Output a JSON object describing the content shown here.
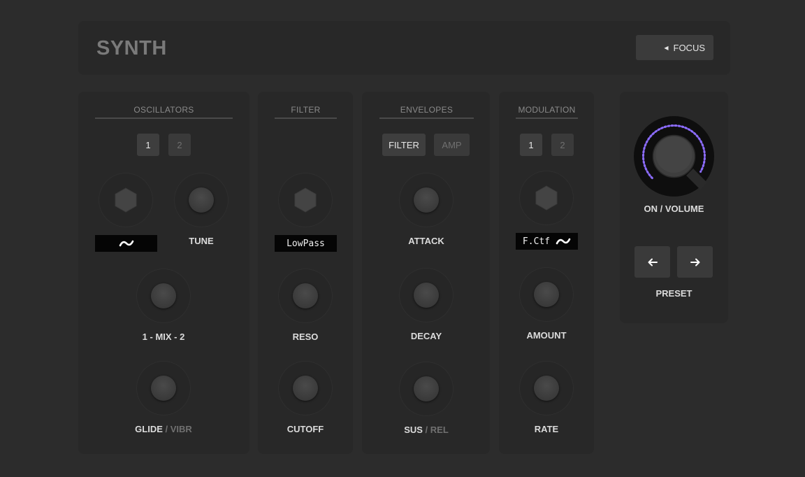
{
  "header": {
    "title": "SYNTH",
    "focus_label": "FOCUS",
    "focus_icon": "triangle-left-icon"
  },
  "oscillators": {
    "title": "OSCILLATORS",
    "toggles": [
      "1",
      "2"
    ],
    "waveform_icon": "sine-wave-icon",
    "tune_label": "TUNE",
    "mix_label": "1 - MIX - 2",
    "glide_label": "GLIDE",
    "vibr_label": "VIBR",
    "slash": "/"
  },
  "filter": {
    "title": "FILTER",
    "type_value": "LowPass",
    "reso_label": "RESO",
    "cutoff_label": "CUTOFF"
  },
  "envelopes": {
    "title": "ENVELOPES",
    "toggles": [
      "FILTER",
      "AMP"
    ],
    "attack_label": "ATTACK",
    "decay_label": "DECAY",
    "sus_label": "SUS",
    "rel_label": "REL",
    "slash": "/"
  },
  "modulation": {
    "title": "MODULATION",
    "toggles": [
      "1",
      "2"
    ],
    "target_value": "F.Ctf",
    "waveform_icon": "sine-wave-icon",
    "amount_label": "AMOUNT",
    "rate_label": "RATE"
  },
  "master": {
    "volume_label": "ON / VOLUME",
    "volume_level": 0.85,
    "preset_label": "PRESET",
    "prev_icon": "arrow-left-icon",
    "next_icon": "arrow-right-icon"
  },
  "colors": {
    "background": "#2c2c2c",
    "panel": "#282828",
    "accent": "#8c6cff"
  }
}
